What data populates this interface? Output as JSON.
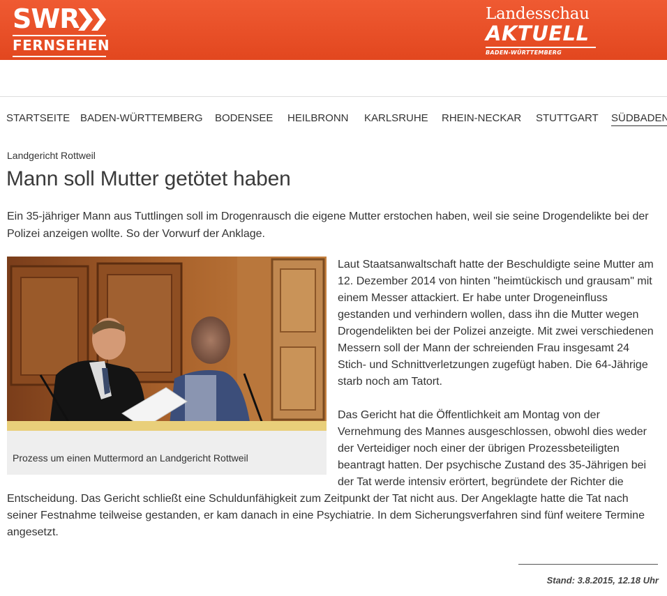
{
  "header": {
    "swr_logo_word": "SWR",
    "swr_logo_sub": "FERNSEHEN",
    "show_logo_top": "Landesschau",
    "show_logo_mid": "AKTUELL",
    "show_logo_bot": "BADEN-WÜRTTEMBERG",
    "brand_color": "#e8502a"
  },
  "nav": {
    "items": [
      {
        "label": "STARTSEITE",
        "active": false
      },
      {
        "label": "BADEN-WÜRTTEMBERG",
        "active": false
      },
      {
        "label": "BODENSEE",
        "active": false
      },
      {
        "label": "HEILBRONN",
        "active": false
      },
      {
        "label": "KARLSRUHE",
        "active": false
      },
      {
        "label": "RHEIN-NECKAR",
        "active": false
      },
      {
        "label": "STUTTGART",
        "active": false
      },
      {
        "label": "SÜDBADEN",
        "active": true
      }
    ]
  },
  "article": {
    "kicker": "Landgericht Rottweil",
    "headline": "Mann soll Mutter getötet haben",
    "teaser": "Ein 35-jähriger Mann aus Tuttlingen soll im Drogenrausch die eigene Mutter erstochen haben, weil sie seine Drogendelikte bei der Polizei anzeigen wollte. So der Vorwurf der Anklage.",
    "image_caption": "Prozess um einen Muttermord an Landgericht Rottweil",
    "paragraphs": [
      "Laut Staatsanwaltschaft hatte der Beschuldigte seine Mutter am 12. Dezember 2014 von hinten \"heimtückisch und grausam\" mit einem Messer attackiert. Er habe unter Drogeneinfluss gestanden und verhindern wollen, dass ihn die Mutter wegen Drogendelikten bei der Polizei anzeigte. Mit zwei verschiedenen Messern soll der Mann der schreienden Frau insgesamt 24 Stich- und Schnittverletzungen zugefügt haben. Die 64-Jährige starb noch am Tatort.",
      "Das Gericht hat die Öffentlichkeit am Montag von der Vernehmung des Mannes ausgeschlossen, obwohl dies weder der Verteidiger noch einer der übrigen Prozessbeteiligten beantragt hatten. Der psychische Zustand des 35-Jährigen bei der Tat werde intensiv erörtert, begründete der Richter die Entscheidung. Das Gericht schließt eine Schuldunfähigkeit zum Zeitpunkt der Tat nicht aus. Der Angeklagte hatte die Tat nach seiner Festnahme teilweise gestanden, er kam danach in eine Psychiatrie. In dem Sicherungsverfahren sind fünf weitere Termine angesetzt."
    ],
    "stand": "Stand: 3.8.2015, 12.18 Uhr"
  }
}
